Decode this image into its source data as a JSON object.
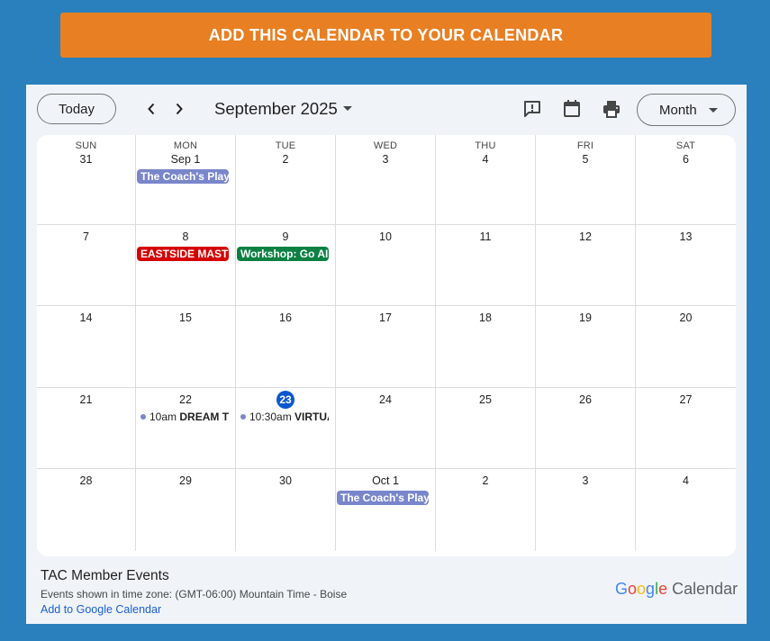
{
  "banner": {
    "label": "ADD THIS CALENDAR TO YOUR CALENDAR"
  },
  "toolbar": {
    "today_label": "Today",
    "month_title": "September 2025",
    "view_label": "Month",
    "icons": [
      "feedback-icon",
      "calendar-icon",
      "print-icon"
    ]
  },
  "weekdays": [
    "SUN",
    "MON",
    "TUE",
    "WED",
    "THU",
    "FRI",
    "SAT"
  ],
  "weeks": [
    [
      {
        "label": "31"
      },
      {
        "label": "Sep 1",
        "events": [
          {
            "type": "allday",
            "title": "The Coach's Playbook",
            "color": "#7986cb"
          }
        ]
      },
      {
        "label": "2"
      },
      {
        "label": "3"
      },
      {
        "label": "4"
      },
      {
        "label": "5"
      },
      {
        "label": "6"
      }
    ],
    [
      {
        "label": "7"
      },
      {
        "label": "8",
        "events": [
          {
            "type": "allday",
            "title": "EASTSIDE MASTERS",
            "color": "#d50000"
          }
        ]
      },
      {
        "label": "9",
        "events": [
          {
            "type": "allday",
            "title": "Workshop: Go AI",
            "color": "#0b8043"
          }
        ]
      },
      {
        "label": "10"
      },
      {
        "label": "11"
      },
      {
        "label": "12"
      },
      {
        "label": "13"
      }
    ],
    [
      {
        "label": "14"
      },
      {
        "label": "15"
      },
      {
        "label": "16"
      },
      {
        "label": "17"
      },
      {
        "label": "18"
      },
      {
        "label": "19"
      },
      {
        "label": "20"
      }
    ],
    [
      {
        "label": "21"
      },
      {
        "label": "22",
        "events": [
          {
            "type": "timed",
            "time": "10am",
            "title": "DREAM TEAM",
            "color": "#7986cb"
          }
        ]
      },
      {
        "label": "23",
        "today": true,
        "events": [
          {
            "type": "timed",
            "time": "10:30am",
            "title": "VIRTUAL",
            "color": "#7986cb"
          }
        ]
      },
      {
        "label": "24"
      },
      {
        "label": "25"
      },
      {
        "label": "26"
      },
      {
        "label": "27"
      }
    ],
    [
      {
        "label": "28"
      },
      {
        "label": "29"
      },
      {
        "label": "30"
      },
      {
        "label": "Oct 1",
        "events": [
          {
            "type": "allday",
            "title": "The Coach's Playbook",
            "color": "#7986cb"
          }
        ]
      },
      {
        "label": "2"
      },
      {
        "label": "3"
      },
      {
        "label": "4"
      }
    ]
  ],
  "footer": {
    "calendar_name": "TAC Member Events",
    "timezone_text": "Events shown in time zone: (GMT-06:00) Mountain Time - Boise",
    "add_link": "Add to Google Calendar",
    "brand_google": "Google",
    "brand_calendar": "Calendar",
    "brand_colors": [
      "#4285f4",
      "#ea4335",
      "#fbbc05",
      "#4285f4",
      "#34a853",
      "#ea4335"
    ]
  }
}
